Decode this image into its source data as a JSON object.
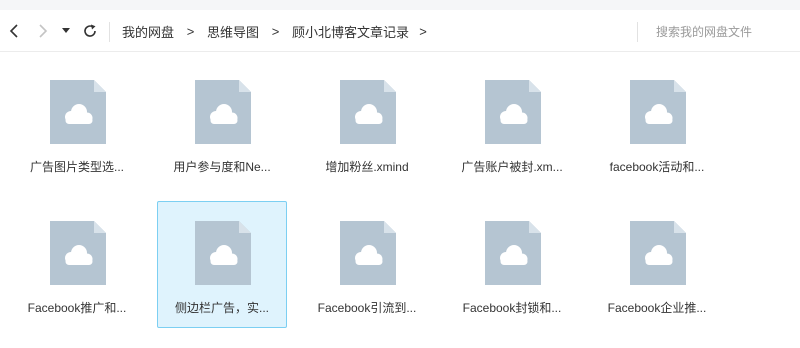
{
  "toolbar": {
    "back_icon": "chevron-left-icon",
    "forward_icon": "chevron-right-icon",
    "dropdown_icon": "caret-down-icon",
    "refresh_icon": "refresh-icon",
    "breadcrumb": [
      "我的网盘",
      "思维导图",
      "顾小北博客文章记录"
    ],
    "breadcrumb_separator": ">",
    "search_placeholder": "搜索我的网盘文件"
  },
  "files": [
    {
      "name": "广告图片类型选...",
      "icon": "cloud-file-icon",
      "selected": false
    },
    {
      "name": "用户参与度和Ne...",
      "icon": "cloud-file-icon",
      "selected": false
    },
    {
      "name": "增加粉丝.xmind",
      "icon": "cloud-file-icon",
      "selected": false
    },
    {
      "name": "广告账户被封.xm...",
      "icon": "cloud-file-icon",
      "selected": false
    },
    {
      "name": "facebook活动和...",
      "icon": "cloud-file-icon",
      "selected": false
    },
    {
      "name": "Facebook推广和...",
      "icon": "cloud-file-icon",
      "selected": false
    },
    {
      "name": "侧边栏广告，实...",
      "icon": "cloud-file-icon",
      "selected": true
    },
    {
      "name": "Facebook引流到...",
      "icon": "cloud-file-icon",
      "selected": false
    },
    {
      "name": "Facebook封锁和...",
      "icon": "cloud-file-icon",
      "selected": false
    },
    {
      "name": "Facebook企业推...",
      "icon": "cloud-file-icon",
      "selected": false
    }
  ],
  "colors": {
    "selection_bg": "#dff3fd",
    "selection_border": "#7ccff2",
    "file_icon": "#b5c5d2",
    "file_fold": "#d8e2ea",
    "cloud": "#ffffff"
  }
}
